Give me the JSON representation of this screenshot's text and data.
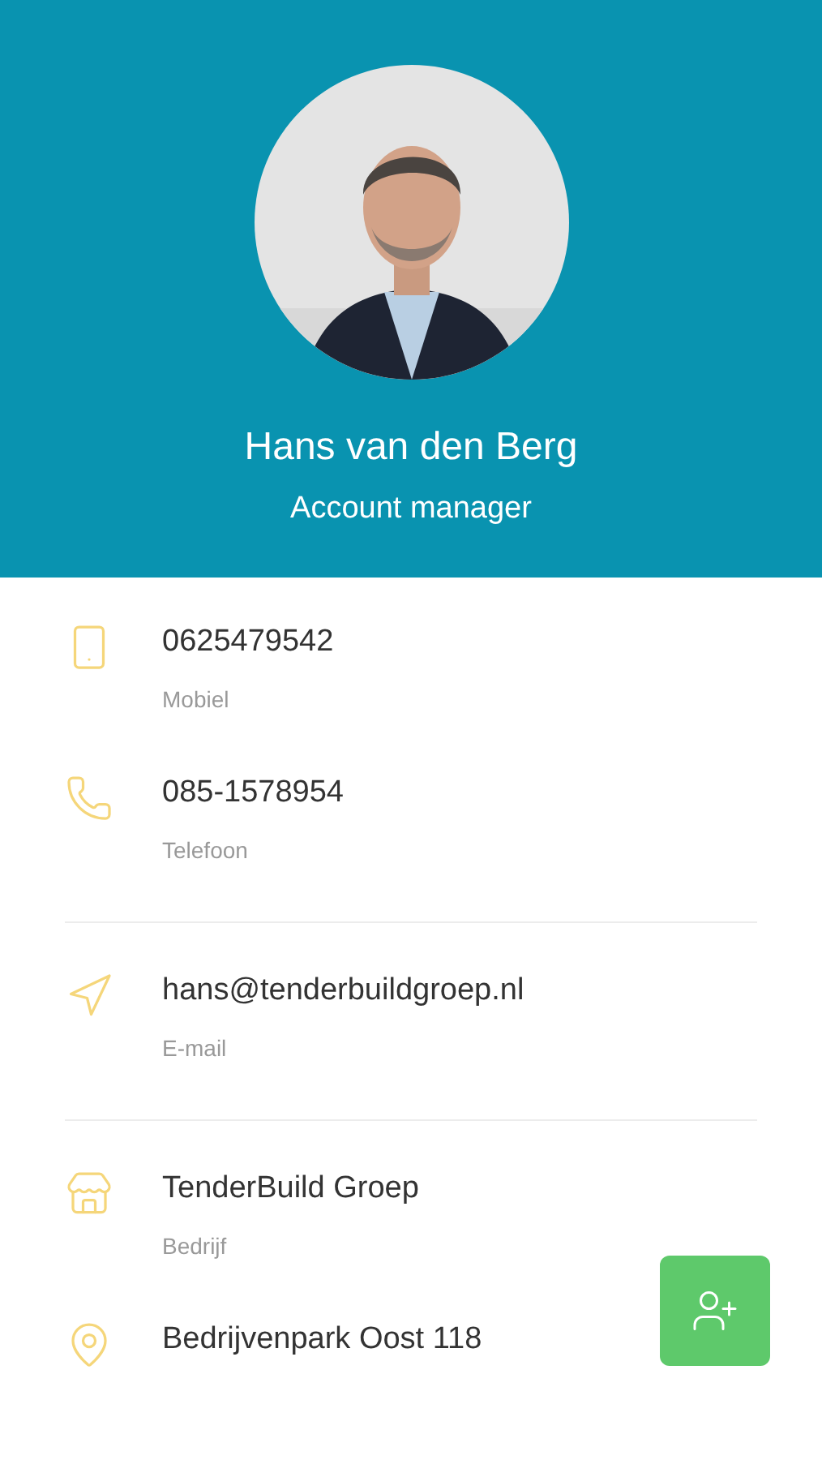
{
  "profile": {
    "name": "Hans van den Berg",
    "role": "Account manager"
  },
  "groups": [
    {
      "items": [
        {
          "kind": "mobile",
          "value": "0625479542",
          "label": "Mobiel"
        },
        {
          "kind": "phone",
          "value": "085-1578954",
          "label": "Telefoon"
        }
      ]
    },
    {
      "items": [
        {
          "kind": "email",
          "value": "hans@tenderbuildgroep.nl",
          "label": "E-mail"
        }
      ]
    },
    {
      "items": [
        {
          "kind": "company",
          "value": "TenderBuild Groep",
          "label": "Bedrijf"
        },
        {
          "kind": "address",
          "value": "Bedrijvenpark Oost 118"
        }
      ]
    }
  ]
}
